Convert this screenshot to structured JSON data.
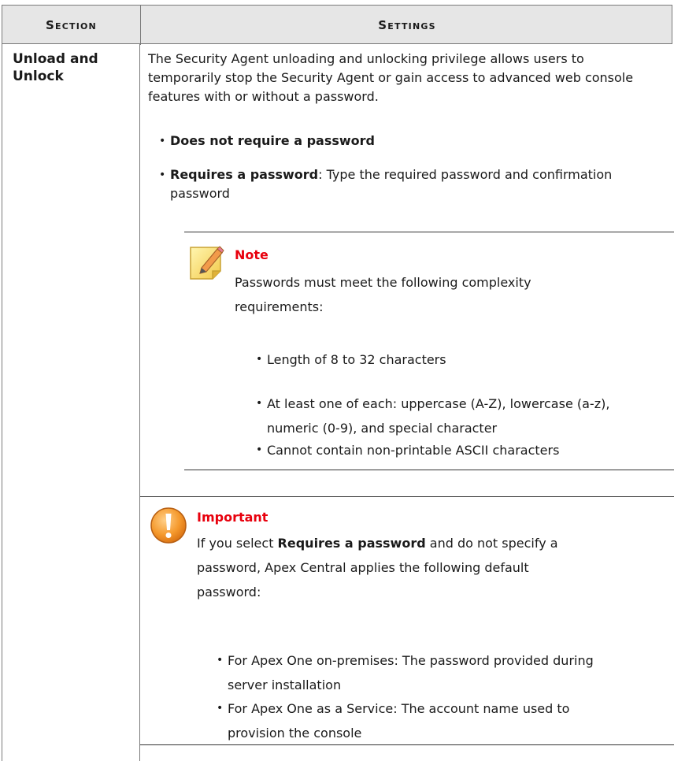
{
  "table": {
    "headers": {
      "section": "Section",
      "settings": "Settings"
    }
  },
  "row": {
    "section_label": "Unload and Unlock",
    "intro": "The Security Agent unloading and unlocking privilege allows users to temporarily stop the Security Agent or gain access to advanced web console features with or without a password.",
    "options": [
      {
        "bold": "Does not require a password",
        "rest": ""
      },
      {
        "bold": "Requires a password",
        "rest": ": Type the required password and confirmation password"
      }
    ]
  },
  "note": {
    "icon": "note-pencil-icon",
    "title": "Note",
    "body": "Passwords must meet the following complexity requirements:",
    "items": [
      "Length of 8 to 32 characters",
      "At least one of each: uppercase (A-Z), lowercase (a-z), numeric (0-9), and special character",
      "Cannot contain non-printable ASCII characters"
    ]
  },
  "important": {
    "icon": "warning-exclamation-icon",
    "title": "Important",
    "body_prefix": "If you select ",
    "body_bold": "Requires a password",
    "body_suffix": " and do not specify a password, Apex Central applies the following default password:",
    "items": [
      "For Apex One on-premises: The password provided during server installation",
      "For Apex One as a Service: The account name used to provision the console"
    ]
  },
  "colors": {
    "callout_title": "#e8000d",
    "header_bg": "#e6e6e6",
    "border": "#7a7a7a"
  }
}
